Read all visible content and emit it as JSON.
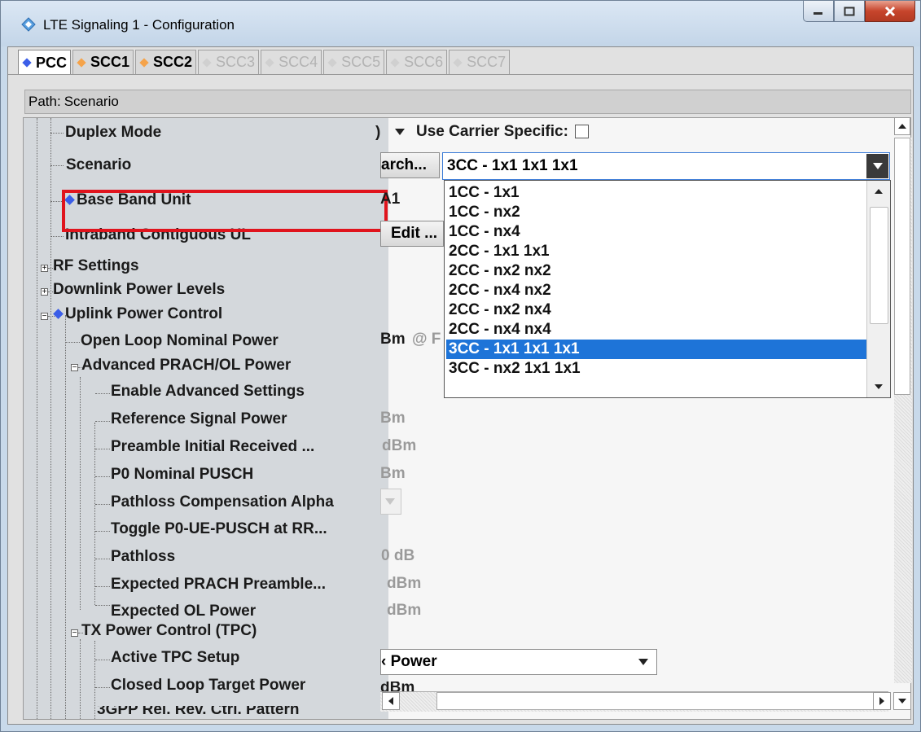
{
  "window": {
    "title": "LTE Signaling 1 - Configuration",
    "controls": [
      "minimize",
      "maximize",
      "close"
    ]
  },
  "tabs": [
    {
      "label": "PCC",
      "state": "active",
      "dot_color": "#3b5ee8"
    },
    {
      "label": "SCC1",
      "state": "enabled",
      "dot_color": "#f5a34a"
    },
    {
      "label": "SCC2",
      "state": "enabled",
      "dot_color": "#f5a34a"
    },
    {
      "label": "SCC3",
      "state": "disabled",
      "dot_color": "#d0d0d0"
    },
    {
      "label": "SCC4",
      "state": "disabled",
      "dot_color": "#d0d0d0"
    },
    {
      "label": "SCC5",
      "state": "disabled",
      "dot_color": "#d0d0d0"
    },
    {
      "label": "SCC6",
      "state": "disabled",
      "dot_color": "#d0d0d0"
    },
    {
      "label": "SCC7",
      "state": "disabled",
      "dot_color": "#d0d0d0"
    }
  ],
  "path": {
    "label": "Path:",
    "value": "Scenario"
  },
  "tree": {
    "duplex_mode": "Duplex Mode",
    "scenario": "Scenario",
    "base_band_unit": "Base Band Unit",
    "intraband_contiguous_ul": "Intraband Contiguous UL",
    "rf_settings": "RF Settings",
    "downlink_power_levels": "Downlink Power Levels",
    "uplink_power_control": "Uplink Power Control",
    "open_loop_nominal_power": "Open Loop Nominal Power",
    "advanced_prach": "Advanced PRACH/OL Power",
    "enable_advanced_settings": "Enable Advanced Settings",
    "reference_signal_power": "Reference Signal Power",
    "preamble_initial": "Preamble Initial Received ...",
    "p0_nominal_pusch": "P0 Nominal PUSCH",
    "pathloss_comp_alpha": "Pathloss Compensation Alpha",
    "toggle_p0": "Toggle P0-UE-PUSCH at RR...",
    "pathloss": "Pathloss",
    "expected_prach": "Expected PRACH Preamble...",
    "expected_ol_power": "Expected OL Power",
    "tx_power_control": "TX Power Control (TPC)",
    "active_tpc_setup": "Active TPC Setup",
    "closed_loop_target": "Closed Loop Target Power",
    "cut_off_item": "3GPP Rel. Rev. Ctrl. Pattern"
  },
  "right": {
    "duplex_value_tail": ")",
    "use_carrier_specific": "Use Carrier Specific:",
    "search_button": "arch...",
    "scenario_selected": "3CC - 1x1 1x1 1x1",
    "base_band_value": "A1",
    "edit_button": "Edit ...",
    "open_loop_unit": "Bm",
    "open_loop_at": "@ F",
    "ref_signal_unit": "Bm",
    "preamble_unit": "dBm",
    "p0_unit": "Bm",
    "pathloss_value": "0 dB",
    "expected_prach_unit": "dBm",
    "expected_ol_unit": "dBm",
    "active_tpc_value": "‹ Power",
    "closed_loop_unit": "dBm"
  },
  "scenario_options": [
    "1CC - 1x1",
    "1CC - nx2",
    "1CC - nx4",
    "2CC - 1x1 1x1",
    "2CC - nx2 nx2",
    "2CC - nx4 nx2",
    "2CC - nx2 nx4",
    "2CC - nx4 nx4",
    "3CC - 1x1 1x1 1x1",
    "3CC - nx2 1x1 1x1"
  ],
  "scenario_selected_index": 8,
  "colors": {
    "highlight_border": "#e0141d",
    "selection": "#1e74d8",
    "pcc_dot": "#3b5ee8",
    "scc_dot": "#f5a34a"
  }
}
